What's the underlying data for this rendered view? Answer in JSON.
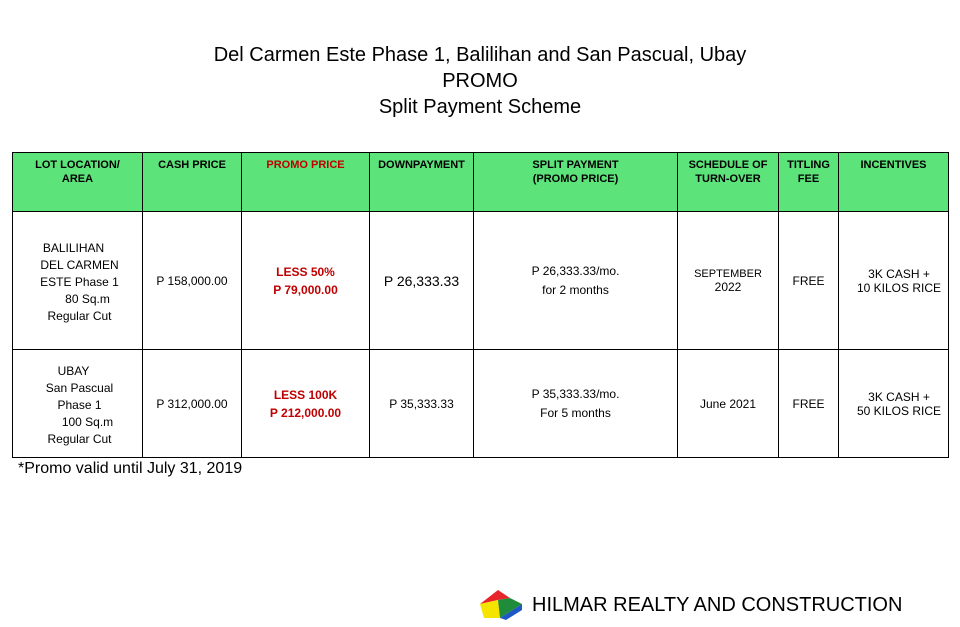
{
  "header": {
    "title": "Del Carmen Este Phase 1, Balilihan and San Pascual, Ubay",
    "subtitle": "PROMO",
    "scheme": "Split Payment Scheme"
  },
  "table": {
    "columns": [
      [
        "LOT LOCATION/",
        "AREA"
      ],
      [
        "CASH PRICE"
      ],
      [
        "PROMO PRICE"
      ],
      [
        "DOWNPAYMENT"
      ],
      [
        "SPLIT PAYMENT",
        "(PROMO PRICE)"
      ],
      [
        "SCHEDULE OF",
        "TURN-OVER"
      ],
      [
        "TITLING",
        "FEE"
      ],
      [
        "INCENTIVES"
      ]
    ],
    "rows": [
      {
        "location": [
          "BALILIHAN",
          "DEL CARMEN",
          "ESTE Phase 1",
          "80 Sq.m",
          "Regular Cut"
        ],
        "cash_price": "P 158,000.00",
        "promo_price": [
          "LESS 50%",
          "P 79,000.00"
        ],
        "downpayment": "P 26,333.33",
        "split_payment": [
          "P 26,333.33/mo.",
          "for 2 months"
        ],
        "turnover": [
          "SEPTEMBER",
          "2022"
        ],
        "titling_fee": "FREE",
        "incentives": [
          "3K CASH +",
          "10 KILOS RICE"
        ]
      },
      {
        "location": [
          "UBAY",
          "San Pascual",
          "Phase 1",
          "100 Sq.m",
          "Regular Cut"
        ],
        "cash_price": "P 312,000.00",
        "promo_price": [
          "LESS 100K",
          "P 212,000.00"
        ],
        "downpayment": "P 35,333.33",
        "split_payment": [
          "P 35,333.33/mo.",
          "For 5 months"
        ],
        "turnover": [
          "June 2021"
        ],
        "titling_fee": "FREE",
        "incentives": [
          "3K CASH +",
          "50 KILOS RICE"
        ]
      }
    ]
  },
  "note": "*Promo valid until July 31, 2019",
  "footer": {
    "company": "HILMAR REALTY AND CONSTRUCTION",
    "logo_colors": [
      "#e8252a",
      "#f5e400",
      "#1e8c3a",
      "#1f57c3"
    ]
  },
  "colors": {
    "header_fill": "#5ce37a",
    "promo_red": "#c00000"
  }
}
